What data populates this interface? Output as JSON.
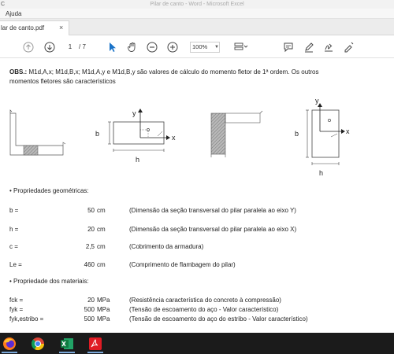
{
  "window": {
    "app_fragment": "C",
    "title": "Pilar de canto - Word - Microsoft Excel"
  },
  "menu": {
    "items": [
      "Ajuda"
    ]
  },
  "tab": {
    "label": "lar de canto.pdf",
    "close": "×"
  },
  "toolbar": {
    "page_current": "1",
    "page_total": "/ 7",
    "zoom": "100%",
    "icons": [
      "up-arrow-icon",
      "down-arrow-icon",
      "select-cursor-icon",
      "hand-icon",
      "zoom-out-icon",
      "zoom-in-icon",
      "page-display-icon",
      "comment-icon",
      "pen-icon",
      "sign-icon",
      "more-icon"
    ]
  },
  "document": {
    "obs_label": "OBS.:",
    "obs_line1": " M1d,A,x; M1d,B,x; M1d,A,y e M1d,B,y são valores de cálculo do momento fletor de 1ª ordem. Os outros",
    "obs_line2": "momentos fletores são característicos",
    "diagram_labels": {
      "b1": "b",
      "h1": "h",
      "x1": "x",
      "y1": "y",
      "b2": "b",
      "h2": "h",
      "x2": "x",
      "y2": "y"
    },
    "section1_title": "• Propriedades geométricas:",
    "geom_rows": [
      {
        "name": "b =",
        "value": "50",
        "unit": "cm",
        "desc": "(Dimensão da seção transversal do pilar paralela ao eixo Y)"
      },
      {
        "name": "h =",
        "value": "20",
        "unit": "cm",
        "desc": "(Dimensão da seção transversal do pilar paralela ao eixo X)"
      },
      {
        "name": "c =",
        "value": "2,5",
        "unit": "cm",
        "desc": "(Cobrimento da armadura)"
      },
      {
        "name": "Le =",
        "value": "460",
        "unit": "cm",
        "desc": "(Comprimento de flambagem do pilar)"
      }
    ],
    "section2_title": "• Propriedade dos materiais:",
    "mat_rows": [
      {
        "name": "fck =",
        "value": "20",
        "unit": "MPa",
        "desc": "(Resistência característica do concreto à compressão)"
      },
      {
        "name": "fyk =",
        "value": "500",
        "unit": "MPa",
        "desc": "(Tensão de escoamento do aço - Valor característico)"
      },
      {
        "name": "fyk,estribo =",
        "value": "500",
        "unit": "MPa",
        "desc": "(Tensão de escoamento do aço do estribo - Valor característico)"
      }
    ]
  },
  "taskbar": {
    "icons": [
      "firefox-icon",
      "chrome-icon",
      "excel-icon",
      "acrobat-icon"
    ],
    "colors": {
      "bar": "#1b1b1b",
      "accent": "#7aa7d8"
    }
  }
}
